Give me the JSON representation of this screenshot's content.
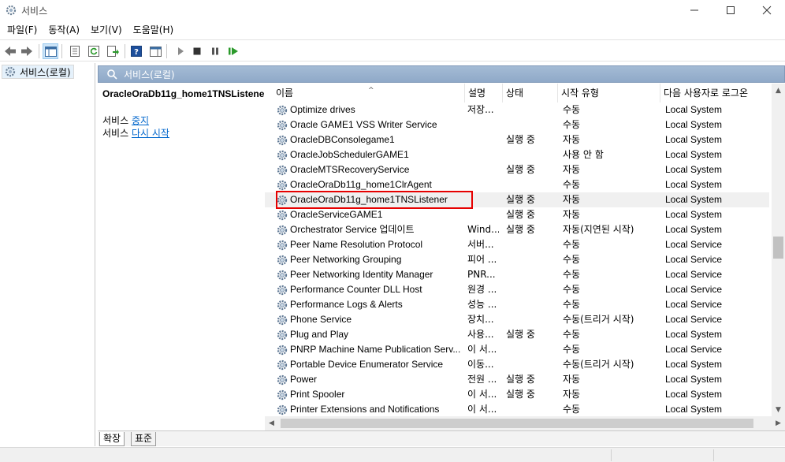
{
  "window": {
    "title": "서비스"
  },
  "menu": [
    "파일(F)",
    "동작(A)",
    "보기(V)",
    "도움말(H)"
  ],
  "tree": {
    "root_label": "서비스(로컬)"
  },
  "panel": {
    "header_label": "서비스(로컬)",
    "selected_service": "OracleOraDb11g_home1TNSListener",
    "action_stop_prefix": "서비스",
    "action_stop_link": "중지",
    "action_restart_prefix": "서비스",
    "action_restart_link": "다시 시작"
  },
  "columns": [
    "이름",
    "설명",
    "상태",
    "시작 유형",
    "다음 사용자로 로그온"
  ],
  "rows": [
    {
      "name": "Optimize drives",
      "desc": "저장...",
      "state": "",
      "start": "수동",
      "logon": "Local System"
    },
    {
      "name": "Oracle GAME1 VSS Writer Service",
      "desc": "",
      "state": "",
      "start": "수동",
      "logon": "Local System"
    },
    {
      "name": "OracleDBConsolegame1",
      "desc": "",
      "state": "실행 중",
      "start": "자동",
      "logon": "Local System"
    },
    {
      "name": "OracleJobSchedulerGAME1",
      "desc": "",
      "state": "",
      "start": "사용 안 함",
      "logon": "Local System"
    },
    {
      "name": "OracleMTSRecoveryService",
      "desc": "",
      "state": "실행 중",
      "start": "자동",
      "logon": "Local System"
    },
    {
      "name": "OracleOraDb11g_home1ClrAgent",
      "desc": "",
      "state": "",
      "start": "수동",
      "logon": "Local System"
    },
    {
      "name": "OracleOraDb11g_home1TNSListener",
      "desc": "",
      "state": "실행 중",
      "start": "자동",
      "logon": "Local System",
      "selected": true
    },
    {
      "name": "OracleServiceGAME1",
      "desc": "",
      "state": "실행 중",
      "start": "자동",
      "logon": "Local System"
    },
    {
      "name": "Orchestrator Service 업데이트",
      "desc": "Wind...",
      "state": "실행 중",
      "start": "자동(지연된 시작)",
      "logon": "Local System"
    },
    {
      "name": "Peer Name Resolution Protocol",
      "desc": "서버...",
      "state": "",
      "start": "수동",
      "logon": "Local Service"
    },
    {
      "name": "Peer Networking Grouping",
      "desc": "피어 ...",
      "state": "",
      "start": "수동",
      "logon": "Local Service"
    },
    {
      "name": "Peer Networking Identity Manager",
      "desc": "PNR...",
      "state": "",
      "start": "수동",
      "logon": "Local Service"
    },
    {
      "name": "Performance Counter DLL Host",
      "desc": "원경 ...",
      "state": "",
      "start": "수동",
      "logon": "Local Service"
    },
    {
      "name": "Performance Logs & Alerts",
      "desc": "성능 ...",
      "state": "",
      "start": "수동",
      "logon": "Local Service"
    },
    {
      "name": "Phone Service",
      "desc": "장치...",
      "state": "",
      "start": "수동(트리거 시작)",
      "logon": "Local Service"
    },
    {
      "name": "Plug and Play",
      "desc": "사용...",
      "state": "실행 중",
      "start": "수동",
      "logon": "Local System"
    },
    {
      "name": "PNRP Machine Name Publication Serv...",
      "desc": "이 서...",
      "state": "",
      "start": "수동",
      "logon": "Local Service"
    },
    {
      "name": "Portable Device Enumerator Service",
      "desc": "이동...",
      "state": "",
      "start": "수동(트리거 시작)",
      "logon": "Local System"
    },
    {
      "name": "Power",
      "desc": "전원 ...",
      "state": "실행 중",
      "start": "자동",
      "logon": "Local System"
    },
    {
      "name": "Print Spooler",
      "desc": "이 서...",
      "state": "실행 중",
      "start": "자동",
      "logon": "Local System"
    },
    {
      "name": "Printer Extensions and Notifications",
      "desc": "이 서...",
      "state": "",
      "start": "수동",
      "logon": "Local System"
    }
  ],
  "tabs": [
    "확장",
    "표준"
  ],
  "colors": {
    "highlight_box": "#e60000",
    "link": "#0066cc",
    "header_band": "#9bb3d0"
  }
}
